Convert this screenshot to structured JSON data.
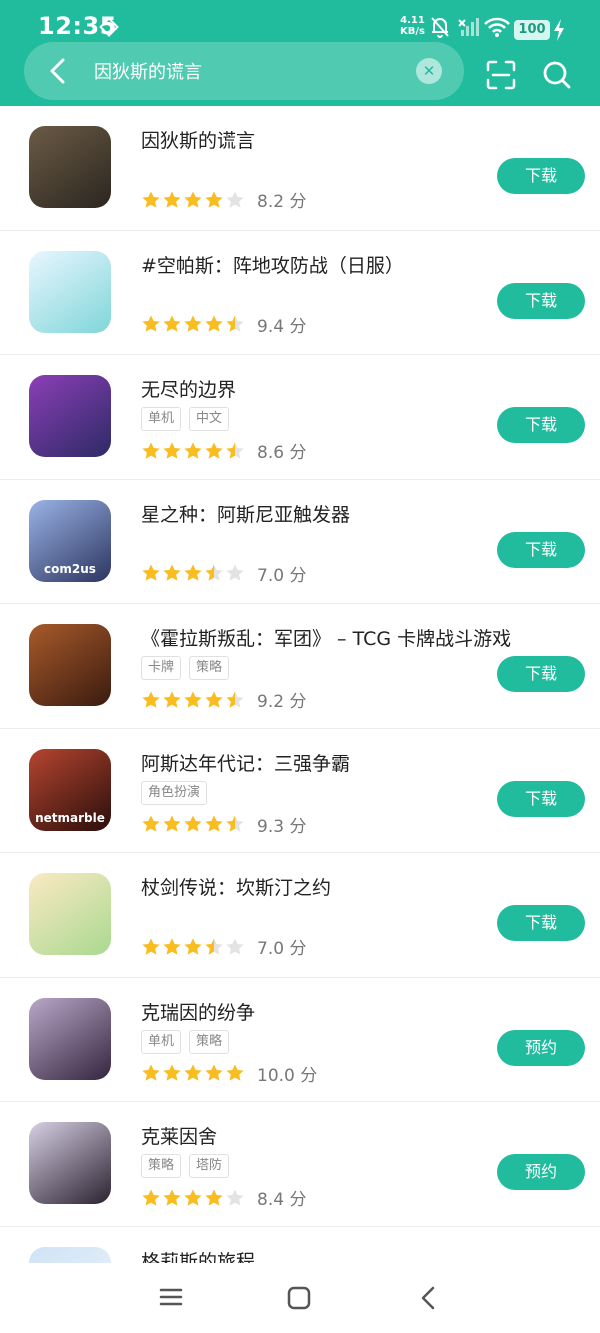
{
  "status": {
    "time": "12:35",
    "net_speed_value": "4.11",
    "net_speed_unit": "KB/s",
    "battery": "100"
  },
  "search": {
    "query": "因狄斯的谎言",
    "clear_icon": "✕"
  },
  "apps": [
    {
      "name": "因狄斯的谎言",
      "tags": [],
      "stars": 4,
      "score_text": "8.2 分",
      "action": "下载",
      "icon_colors": [
        "#6b5b45",
        "#2b2620"
      ],
      "icon_label": ""
    },
    {
      "name": "#空帕斯：阵地攻防战（日服）",
      "tags": [],
      "stars": 4.5,
      "score_text": "9.4 分",
      "action": "下载",
      "icon_colors": [
        "#e9f6ff",
        "#7fd6d9"
      ],
      "icon_label": ""
    },
    {
      "name": "无尽的边界",
      "tags": [
        "单机",
        "中文"
      ],
      "stars": 4.5,
      "score_text": "8.6 分",
      "action": "下载",
      "icon_colors": [
        "#8b3fb6",
        "#2d2a66"
      ],
      "icon_label": ""
    },
    {
      "name": "星之种：阿斯尼亚触发器",
      "tags": [],
      "stars": 3.5,
      "score_text": "7.0 分",
      "action": "下载",
      "icon_colors": [
        "#9ab3e6",
        "#2c3560"
      ],
      "icon_label": "com2us"
    },
    {
      "name": "《霍拉斯叛乱：军团》 – TCG 卡牌战斗游戏",
      "tags": [
        "卡牌",
        "策略"
      ],
      "stars": 4.5,
      "score_text": "9.2 分",
      "action": "下载",
      "icon_colors": [
        "#a85a2a",
        "#3a1b10"
      ],
      "icon_label": ""
    },
    {
      "name": "阿斯达年代记：三强争霸",
      "tags": [
        "角色扮演"
      ],
      "stars": 4.5,
      "score_text": "9.3 分",
      "action": "下载",
      "icon_colors": [
        "#b5452f",
        "#2a0e0c"
      ],
      "icon_label": "netmarble"
    },
    {
      "name": "杖剑传说：坎斯汀之约",
      "tags": [],
      "stars": 3.5,
      "score_text": "7.0 分",
      "action": "下载",
      "icon_colors": [
        "#fbe9c4",
        "#a9d98f"
      ],
      "icon_label": ""
    },
    {
      "name": "克瑞因的纷争",
      "tags": [
        "单机",
        "策略"
      ],
      "stars": 5,
      "score_text": "10.0 分",
      "action": "预约",
      "icon_colors": [
        "#b9a7c8",
        "#35253f"
      ],
      "icon_label": ""
    },
    {
      "name": "克莱因舍",
      "tags": [
        "策略",
        "塔防"
      ],
      "stars": 4,
      "score_text": "8.4 分",
      "action": "预约",
      "icon_colors": [
        "#d7d0e4",
        "#2a2230"
      ],
      "icon_label": ""
    },
    {
      "name": "格莉斯的旅程",
      "tags": [],
      "stars": 0,
      "score_text": "",
      "action": "",
      "icon_colors": [
        "#cfe3f5",
        "#eef4fb"
      ],
      "icon_label": ""
    }
  ],
  "colors": {
    "accent": "#21bb9d",
    "star_filled": "#f9bd1f",
    "star_empty": "#e3e3e3"
  }
}
